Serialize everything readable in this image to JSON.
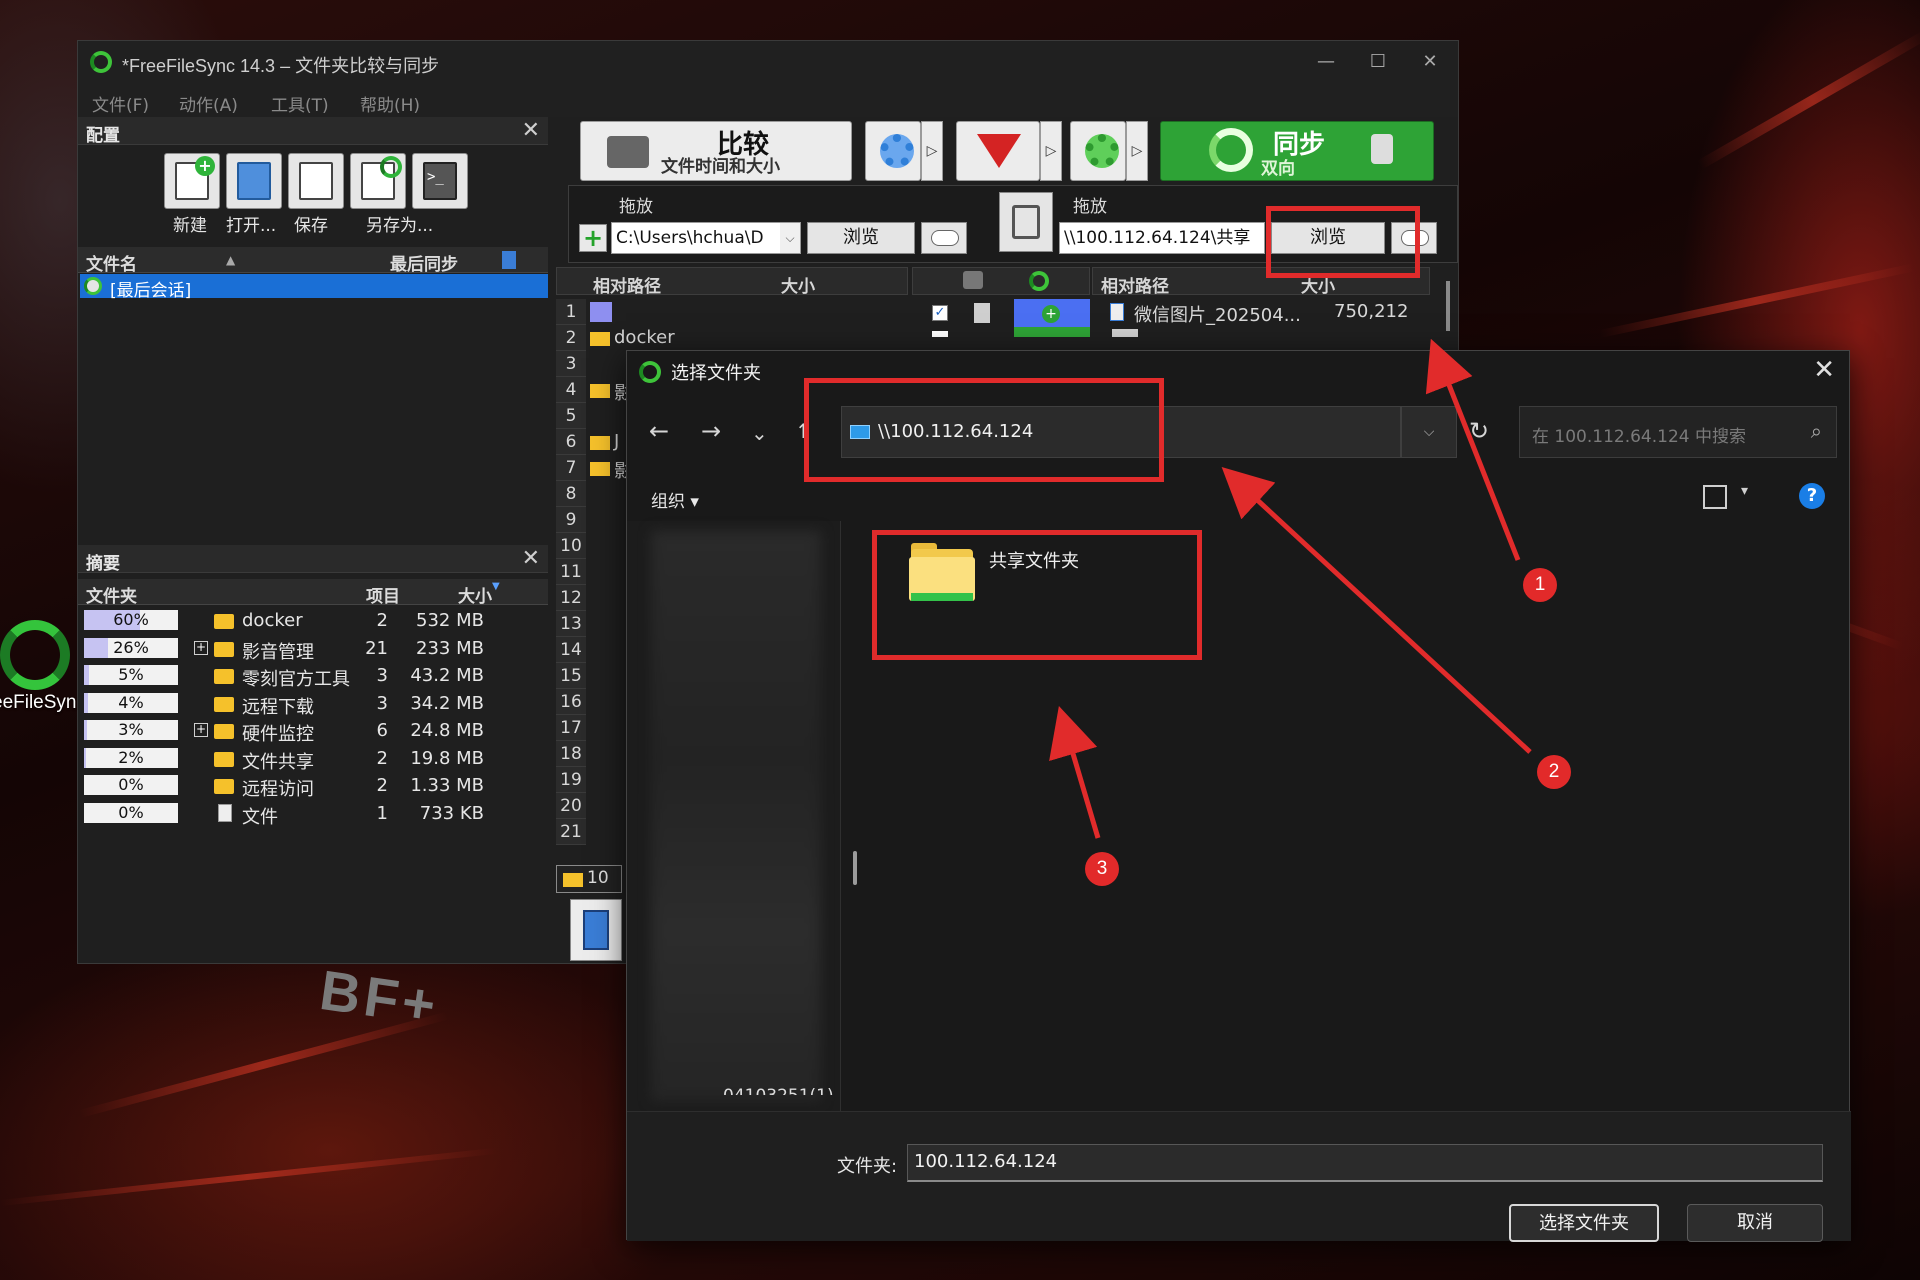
{
  "main_window": {
    "title": "*FreeFileSync 14.3 – 文件夹比较与同步",
    "controls": {
      "minimize": "—",
      "maximize": "☐",
      "close": "✕"
    },
    "menu": [
      "文件(F)",
      "动作(A)",
      "工具(T)",
      "帮助(H)"
    ]
  },
  "config_panel": {
    "title": "配置",
    "close": "✕",
    "buttons": [
      {
        "label": "新建",
        "icon": "new-config-icon"
      },
      {
        "label": "打开...",
        "icon": "open-config-icon"
      },
      {
        "label": "保存",
        "icon": "save-config-icon"
      },
      {
        "label": "另存为...",
        "icon": "save-as-batch-icon"
      }
    ],
    "batch_button_icon_text": ">_",
    "columns": {
      "name": "文件名",
      "sort": "▲",
      "last_sync": "最后同步"
    },
    "selected_session": "[最后会话]"
  },
  "summary_panel": {
    "title": "摘要",
    "close": "✕",
    "columns": {
      "folder": "文件夹",
      "items": "项目",
      "size": "大小",
      "sort": "▼"
    },
    "expand_symbol": "+",
    "rows": [
      {
        "percent": "60%",
        "fraction": 0.6,
        "expand": false,
        "type": "folder",
        "name": "docker",
        "items": "2",
        "size": "532 MB"
      },
      {
        "percent": "26%",
        "fraction": 0.26,
        "expand": true,
        "type": "folder",
        "name": "影音管理",
        "items": "21",
        "size": "233 MB"
      },
      {
        "percent": "5%",
        "fraction": 0.05,
        "expand": false,
        "type": "folder",
        "name": "零刻官方工具",
        "items": "3",
        "size": "43.2 MB"
      },
      {
        "percent": "4%",
        "fraction": 0.04,
        "expand": false,
        "type": "folder",
        "name": "远程下载",
        "items": "3",
        "size": "34.2 MB"
      },
      {
        "percent": "3%",
        "fraction": 0.03,
        "expand": true,
        "type": "folder",
        "name": "硬件监控",
        "items": "6",
        "size": "24.8 MB"
      },
      {
        "percent": "2%",
        "fraction": 0.02,
        "expand": false,
        "type": "folder",
        "name": "文件共享",
        "items": "2",
        "size": "19.8 MB"
      },
      {
        "percent": "0%",
        "fraction": 0.0,
        "expand": false,
        "type": "folder",
        "name": "远程访问",
        "items": "2",
        "size": "1.33 MB"
      },
      {
        "percent": "0%",
        "fraction": 0.0,
        "expand": false,
        "type": "file",
        "name": "文件",
        "items": "1",
        "size": "733 KB"
      }
    ]
  },
  "toolbar": {
    "compare_label": "比较",
    "compare_sub": "文件时间和大小",
    "sync_label": "同步",
    "sync_sub": "双向",
    "arrow": "▷"
  },
  "folder_pair": {
    "left_label": "拖放",
    "left_path": "C:\\Users\\hchua\\D",
    "left_browse": "浏览",
    "right_label": "拖放",
    "right_path": "\\\\100.112.64.124\\共享",
    "right_browse": "浏览",
    "dropdown": "⌵"
  },
  "grid": {
    "left_columns": {
      "path": "相对路径",
      "size": "大小"
    },
    "right_columns": {
      "path": "相对路径",
      "size": "大小"
    },
    "row_numbers": [
      "1",
      "2",
      "3",
      "4",
      "5",
      "6",
      "7",
      "8",
      "9",
      "10",
      "11",
      "12",
      "13",
      "14",
      "15",
      "16",
      "17",
      "18",
      "19",
      "20",
      "21"
    ],
    "left_rows": [
      {
        "row": 2,
        "text": "docker"
      },
      {
        "row": 4,
        "text": "影"
      },
      {
        "row": 6,
        "text": "J"
      },
      {
        "row": 7,
        "text": "影音"
      }
    ],
    "right_first_row": {
      "name": "微信图片_202504...",
      "size": "750,212"
    },
    "status_folder_count": "10"
  },
  "dialog": {
    "title": "选择文件夹",
    "close": "✕",
    "nav": {
      "back": "←",
      "forward": "→",
      "recent": "⌄",
      "up": "↑",
      "refresh": "↻"
    },
    "address": "\\\\100.112.64.124",
    "address_dropdown": "⌵",
    "search_placeholder": "在 100.112.64.124 中搜索",
    "search_icon": "⌕",
    "organize": "组织 ▾",
    "view_dropdown": "▾",
    "help": "?",
    "folder_name": "共享文件夹",
    "nav_bottom_text": "04103251(1)",
    "folder_field_label": "文件夹:",
    "folder_field_value": "100.112.64.124",
    "select_button": "选择文件夹",
    "cancel_button": "取消"
  },
  "desktop": {
    "icon_label": "eeFileSyn",
    "wallpaper_text": "BF+"
  },
  "annotations": {
    "numbers": [
      "1",
      "2",
      "3"
    ],
    "color": "#e12b2b"
  }
}
